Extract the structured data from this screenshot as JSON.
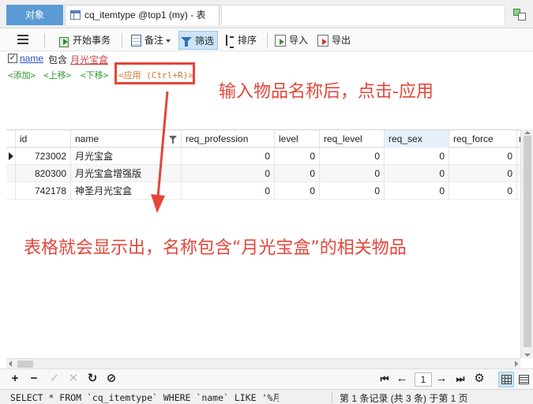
{
  "tabs": {
    "objects_label": "对象",
    "table_tab_label": "cq_itemtype @top1 (my) - 表"
  },
  "toolbar": {
    "begin_transaction": "开始事务",
    "memo": "备注",
    "filter": "筛选",
    "sort": "排序",
    "import": "导入",
    "export": "导出"
  },
  "filter": {
    "field": "name",
    "operator": "包含",
    "value": "月光宝盒",
    "checked": true
  },
  "filter_commands": {
    "add": "<添加>",
    "move_up": "<上移>",
    "move_down": "<下移>",
    "apply": "<应用 (Ctrl+R)>"
  },
  "annotations": {
    "step_hint": "输入物品名称后，点击-应用",
    "result_hint": "表格就会显示出，名称包含“月光宝盒”的相关物品",
    "highlight_color": "#e3463a"
  },
  "grid": {
    "columns": [
      "id",
      "name",
      "req_profession",
      "level",
      "req_level",
      "req_sex",
      "req_force",
      "r"
    ],
    "rows": [
      {
        "id": "723002",
        "name": "月光宝盒",
        "req_profession": "0",
        "level": "0",
        "req_level": "0",
        "req_sex": "0",
        "req_force": "0"
      },
      {
        "id": "820300",
        "name": "月光宝盒增强版",
        "req_profession": "0",
        "level": "0",
        "req_level": "0",
        "req_sex": "0",
        "req_force": "0"
      },
      {
        "id": "742178",
        "name": "神圣月光宝盒",
        "req_profession": "0",
        "level": "0",
        "req_level": "0",
        "req_sex": "0",
        "req_force": "0"
      }
    ],
    "selected_column": "req_sex"
  },
  "bottombar": {
    "add_icon": "plus-icon",
    "delete_icon": "minus-icon",
    "apply_icon": "check-icon",
    "cancel_icon": "cross-icon",
    "refresh_icon": "refresh-icon",
    "stop_icon": "stop-icon",
    "current_page": "1"
  },
  "status": {
    "sql": "SELECT * FROM `cq_itemtype` WHERE `name` LIKE '%月光宝",
    "records": "第 1 条记录 (共 3 条) 于第 1 页"
  }
}
